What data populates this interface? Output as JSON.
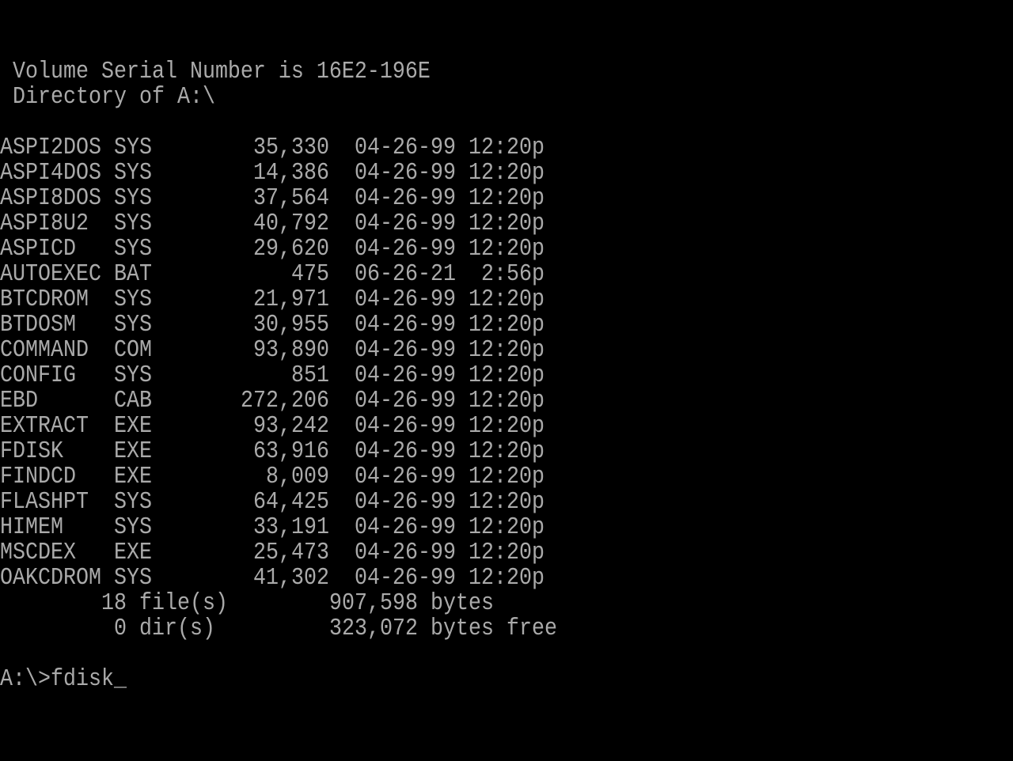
{
  "colors": {
    "background": "#000000",
    "text": "#aaaaaa"
  },
  "header": {
    "volume_serial": " Volume Serial Number is 16E2-196E",
    "directory_of": " Directory of A:\\"
  },
  "files": [
    {
      "name": "ASPI2DOS",
      "ext": "SYS",
      "size": "35,330",
      "date": "04-26-99",
      "time": "12:20p"
    },
    {
      "name": "ASPI4DOS",
      "ext": "SYS",
      "size": "14,386",
      "date": "04-26-99",
      "time": "12:20p"
    },
    {
      "name": "ASPI8DOS",
      "ext": "SYS",
      "size": "37,564",
      "date": "04-26-99",
      "time": "12:20p"
    },
    {
      "name": "ASPI8U2",
      "ext": "SYS",
      "size": "40,792",
      "date": "04-26-99",
      "time": "12:20p"
    },
    {
      "name": "ASPICD",
      "ext": "SYS",
      "size": "29,620",
      "date": "04-26-99",
      "time": "12:20p"
    },
    {
      "name": "AUTOEXEC",
      "ext": "BAT",
      "size": "475",
      "date": "06-26-21",
      "time": "2:56p"
    },
    {
      "name": "BTCDROM",
      "ext": "SYS",
      "size": "21,971",
      "date": "04-26-99",
      "time": "12:20p"
    },
    {
      "name": "BTDOSM",
      "ext": "SYS",
      "size": "30,955",
      "date": "04-26-99",
      "time": "12:20p"
    },
    {
      "name": "COMMAND",
      "ext": "COM",
      "size": "93,890",
      "date": "04-26-99",
      "time": "12:20p"
    },
    {
      "name": "CONFIG",
      "ext": "SYS",
      "size": "851",
      "date": "04-26-99",
      "time": "12:20p"
    },
    {
      "name": "EBD",
      "ext": "CAB",
      "size": "272,206",
      "date": "04-26-99",
      "time": "12:20p"
    },
    {
      "name": "EXTRACT",
      "ext": "EXE",
      "size": "93,242",
      "date": "04-26-99",
      "time": "12:20p"
    },
    {
      "name": "FDISK",
      "ext": "EXE",
      "size": "63,916",
      "date": "04-26-99",
      "time": "12:20p"
    },
    {
      "name": "FINDCD",
      "ext": "EXE",
      "size": "8,009",
      "date": "04-26-99",
      "time": "12:20p"
    },
    {
      "name": "FLASHPT",
      "ext": "SYS",
      "size": "64,425",
      "date": "04-26-99",
      "time": "12:20p"
    },
    {
      "name": "HIMEM",
      "ext": "SYS",
      "size": "33,191",
      "date": "04-26-99",
      "time": "12:20p"
    },
    {
      "name": "MSCDEX",
      "ext": "EXE",
      "size": "25,473",
      "date": "04-26-99",
      "time": "12:20p"
    },
    {
      "name": "OAKCDROM",
      "ext": "SYS",
      "size": "41,302",
      "date": "04-26-99",
      "time": "12:20p"
    }
  ],
  "summary": {
    "files_count": "18 file(s)",
    "files_bytes": "907,598 bytes",
    "dirs_count": "0 dir(s)",
    "free_bytes": "323,072 bytes free"
  },
  "prompt": {
    "text": "A:\\>",
    "command": "fdisk",
    "cursor": "_"
  }
}
